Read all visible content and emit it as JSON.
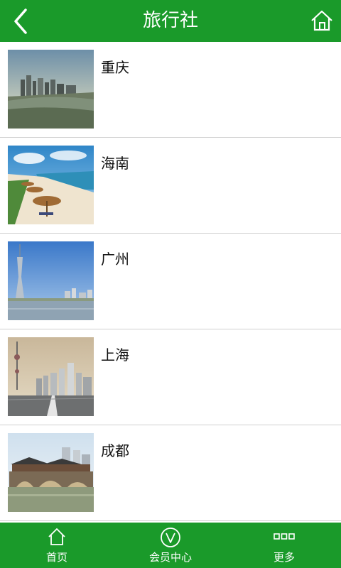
{
  "header": {
    "title": "旅行社",
    "back_icon": "back-arrow-icon",
    "home_icon": "home-icon"
  },
  "destinations": [
    {
      "name": "重庆"
    },
    {
      "name": "海南"
    },
    {
      "name": "广州"
    },
    {
      "name": "上海"
    },
    {
      "name": "成都"
    }
  ],
  "tabbar": {
    "tabs": [
      {
        "label": "首页",
        "icon": "home-icon"
      },
      {
        "label": "会员中心",
        "icon": "vip-icon"
      },
      {
        "label": "更多",
        "icon": "more-icon"
      }
    ]
  },
  "colors": {
    "brand_green": "#1a9a2a",
    "divider": "#d0d0d0"
  }
}
